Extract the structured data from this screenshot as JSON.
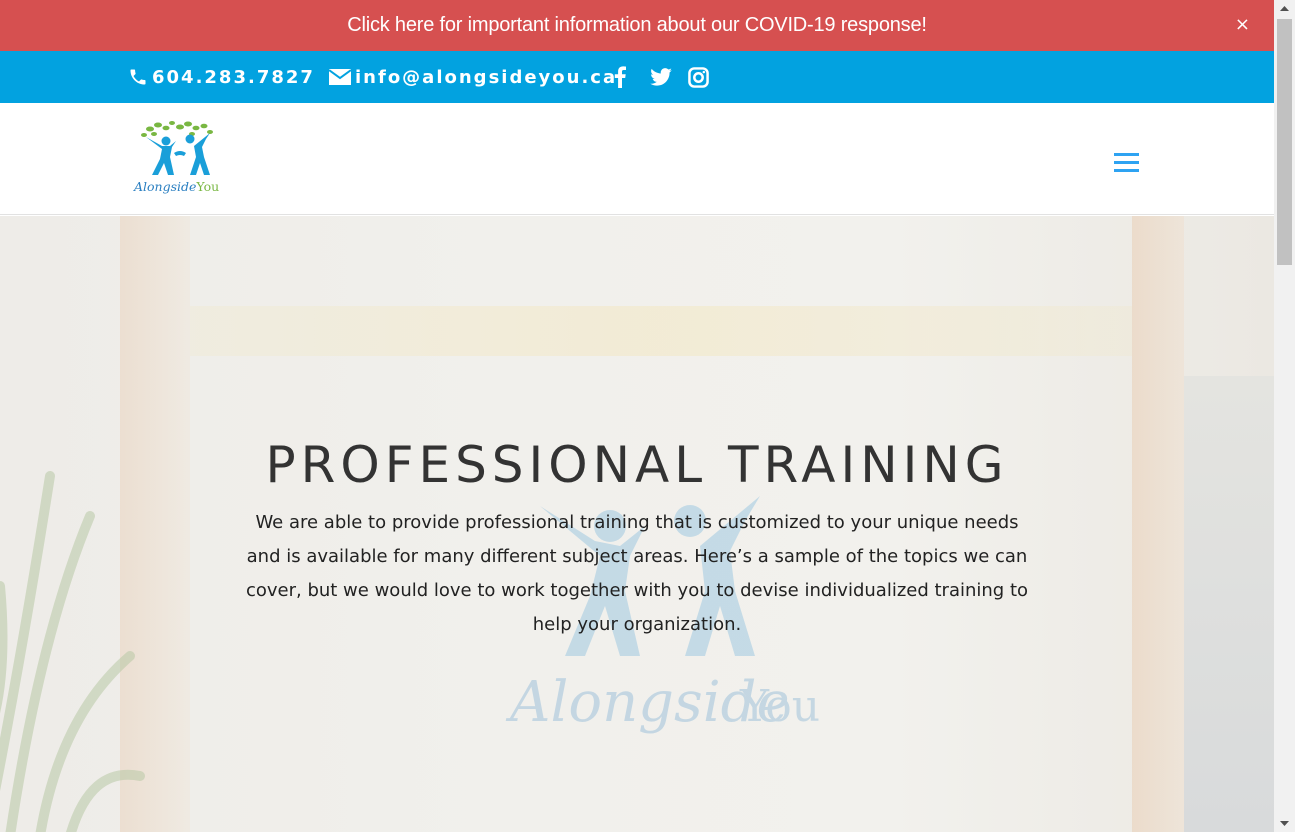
{
  "covid_banner": {
    "text": "Click here for important information about our COVID-19 response!",
    "close_symbol": "×",
    "background": "#d65050"
  },
  "contact_bar": {
    "background": "#02a2e0",
    "phone": "604.283.7827",
    "email": "info@alongsideyou.ca",
    "icons": [
      "phone-icon",
      "envelope-icon",
      "facebook-icon",
      "twitter-icon",
      "instagram-icon"
    ]
  },
  "header": {
    "logo": {
      "word1": "Alongside",
      "word2": "You"
    },
    "menu_icon": "hamburger-menu-icon",
    "accent": "#2ea3f2"
  },
  "hero": {
    "title": "PROFESSIONAL TRAINING",
    "body": "We are able to provide professional training that is customized to your unique needs and is available for many different subject areas. Here’s a sample of the topics we can cover, but we would love to work together with you to devise individualized training to help your organization."
  }
}
